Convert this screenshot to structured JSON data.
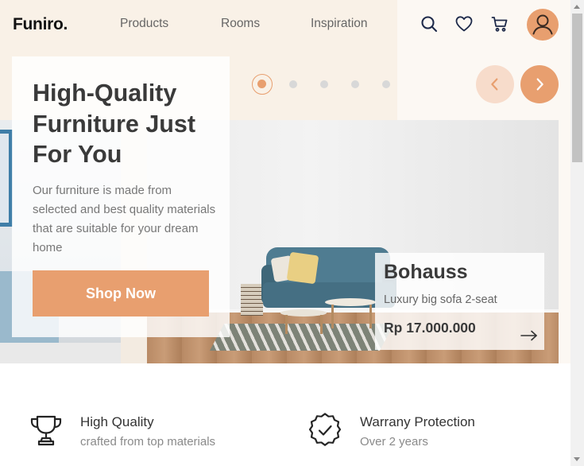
{
  "header": {
    "logo": "Funiro.",
    "nav": [
      "Products",
      "Rooms",
      "Inspiration"
    ],
    "icons": [
      "search-icon",
      "heart-icon",
      "cart-icon",
      "user-icon"
    ]
  },
  "hero": {
    "title": "High-Quality Furniture Just For You",
    "description": "Our furniture is made from selected and best quality materials that are suitable for your dream home",
    "button_label": "Shop Now",
    "slider": {
      "total": 5,
      "active_index": 0
    }
  },
  "product": {
    "name": "Bohauss",
    "subtitle": "Luxury big sofa 2-seat",
    "price": "Rp 17.000.000"
  },
  "features": [
    {
      "icon": "trophy-icon",
      "title": "High Quality",
      "subtitle": "crafted from top materials"
    },
    {
      "icon": "verified-badge-icon",
      "title": "Warrany Protection",
      "subtitle": "Over 2 years"
    }
  ],
  "colors": {
    "accent": "#e89f6f",
    "accent_light": "#f7dccb",
    "hero_bg": "#fcf8f3",
    "hero_peach": "#f9f1e7",
    "text_dark": "#3a3a3a",
    "text_muted": "#777777"
  }
}
